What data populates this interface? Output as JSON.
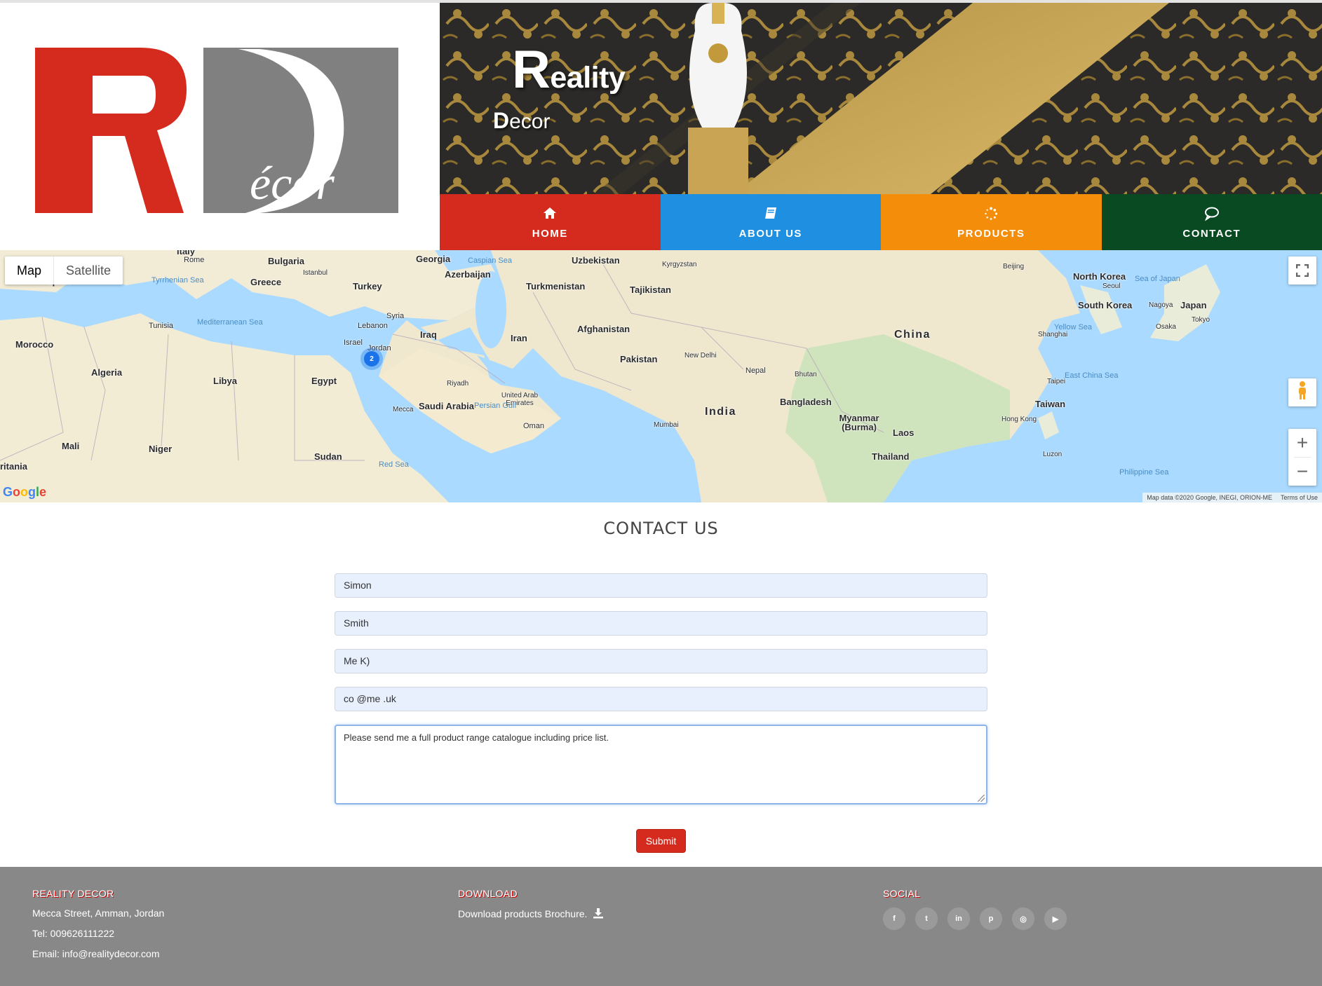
{
  "brand": {
    "logo_letters": "R",
    "logo_d": "D",
    "logo_text": "écor",
    "banner_title_big": "R",
    "banner_title_rest": "eality",
    "banner_sub_big": "D",
    "banner_sub_rest": "ecor",
    "colors": {
      "red": "#d52b1e",
      "gray": "#808080"
    }
  },
  "nav": {
    "items": [
      {
        "label": "HOME",
        "icon": "home-icon",
        "color": "#d52b1e"
      },
      {
        "label": "ABOUT US",
        "icon": "book-icon",
        "color": "#1e8fe1"
      },
      {
        "label": "PRODUCTS",
        "icon": "spinner-icon",
        "color": "#f48d0a"
      },
      {
        "label": "CONTACT",
        "icon": "speech-bubble-icon",
        "color": "#0a4a22"
      }
    ]
  },
  "map": {
    "type_active": "Map",
    "type_other": "Satellite",
    "google": "Google",
    "attribution": "Map data ©2020 Google, INEGI, ORION-ME",
    "terms": "Terms of Use",
    "cluster_count": "2",
    "labels": [
      {
        "t": "Bulgaria",
        "c": ""
      },
      {
        "t": "Georgia",
        "c": ""
      },
      {
        "t": "Uzbekistan",
        "c": ""
      },
      {
        "t": "Kyrgyzstan",
        "c": "xs"
      },
      {
        "t": "Italy",
        "c": ""
      },
      {
        "t": "Rome",
        "c": "sm"
      },
      {
        "t": "Spain",
        "c": ""
      },
      {
        "t": "Istanbul",
        "c": "xs"
      },
      {
        "t": "Greece",
        "c": ""
      },
      {
        "t": "Azerbaijan",
        "c": ""
      },
      {
        "t": "Turkey",
        "c": ""
      },
      {
        "t": "Turkmenistan",
        "c": ""
      },
      {
        "t": "Tajikistan",
        "c": ""
      },
      {
        "t": "North Korea",
        "c": ""
      },
      {
        "t": "South Korea",
        "c": ""
      },
      {
        "t": "Japan",
        "c": ""
      },
      {
        "t": "Syria",
        "c": "sm"
      },
      {
        "t": "Lebanon",
        "c": "sm"
      },
      {
        "t": "Tunisia",
        "c": "sm"
      },
      {
        "t": "Morocco",
        "c": ""
      },
      {
        "t": "Iraq",
        "c": ""
      },
      {
        "t": "Afghanistan",
        "c": ""
      },
      {
        "t": "Israel",
        "c": "sm"
      },
      {
        "t": "Jordan",
        "c": "sm"
      },
      {
        "t": "Iran",
        "c": ""
      },
      {
        "t": "China",
        "c": "lg"
      },
      {
        "t": "Pakistan",
        "c": ""
      },
      {
        "t": "New Delhi",
        "c": "xs"
      },
      {
        "t": "Nepal",
        "c": "sm"
      },
      {
        "t": "Bhutan",
        "c": "xs"
      },
      {
        "t": "Shanghai",
        "c": "xs"
      },
      {
        "t": "Algeria",
        "c": ""
      },
      {
        "t": "Libya",
        "c": ""
      },
      {
        "t": "Egypt",
        "c": ""
      },
      {
        "t": "Riyadh",
        "c": "xs"
      },
      {
        "t": "United Arab Emirates",
        "c": "xs"
      },
      {
        "t": "Saudi Arabia",
        "c": ""
      },
      {
        "t": "India",
        "c": "lg"
      },
      {
        "t": "Bangladesh",
        "c": ""
      },
      {
        "t": "Taipei",
        "c": "xs"
      },
      {
        "t": "Taiwan",
        "c": ""
      },
      {
        "t": "Mecca",
        "c": "xs"
      },
      {
        "t": "Oman",
        "c": "sm"
      },
      {
        "t": "Mumbai",
        "c": "xs"
      },
      {
        "t": "Myanmar (Burma)",
        "c": ""
      },
      {
        "t": "Hong Kong",
        "c": "xs"
      },
      {
        "t": "Laos",
        "c": ""
      },
      {
        "t": "Mali",
        "c": ""
      },
      {
        "t": "Niger",
        "c": ""
      },
      {
        "t": "Sudan",
        "c": ""
      },
      {
        "t": "Thailand",
        "c": ""
      },
      {
        "t": "Beijing",
        "c": "xs"
      },
      {
        "t": "Seoul",
        "c": "xs"
      },
      {
        "t": "Nagoya",
        "c": "xs"
      },
      {
        "t": "Osaka",
        "c": "xs"
      },
      {
        "t": "Tokyo",
        "c": "xs"
      },
      {
        "t": "Luzon",
        "c": "xs"
      },
      {
        "t": "ritania",
        "c": ""
      }
    ],
    "seas": [
      {
        "t": "Caspian Sea"
      },
      {
        "t": "Tyrrhenian Sea"
      },
      {
        "t": "Mediterranean Sea"
      },
      {
        "t": "Sea of Japan"
      },
      {
        "t": "Yellow Sea"
      },
      {
        "t": "East China Sea"
      },
      {
        "t": "Persian Gulf"
      },
      {
        "t": "Red Sea"
      },
      {
        "t": "Philippine Sea"
      }
    ]
  },
  "contact": {
    "title": "CONTACT US",
    "first_name": "Simon",
    "last_name": "Smith",
    "company": "Me K)",
    "email": "co @me .uk",
    "message": "Please send me a full product range catalogue including price list.",
    "submit": "Submit"
  },
  "footer": {
    "col1_title": "REALITY DECOR",
    "address": "Mecca Street, Amman, Jordan",
    "tel": "Tel: 009626111222",
    "email": "Email: info@realitydecor.com",
    "col2_title": "DOWNLOAD",
    "download_text": "Download products Brochure.",
    "col3_title": "SOCIAL",
    "social": [
      {
        "icon": "facebook-icon",
        "glyph": "f"
      },
      {
        "icon": "twitter-icon",
        "glyph": "t"
      },
      {
        "icon": "linkedin-icon",
        "glyph": "in"
      },
      {
        "icon": "pinterest-icon",
        "glyph": "p"
      },
      {
        "icon": "instagram-icon",
        "glyph": "◎"
      },
      {
        "icon": "youtube-icon",
        "glyph": "▶"
      }
    ]
  }
}
